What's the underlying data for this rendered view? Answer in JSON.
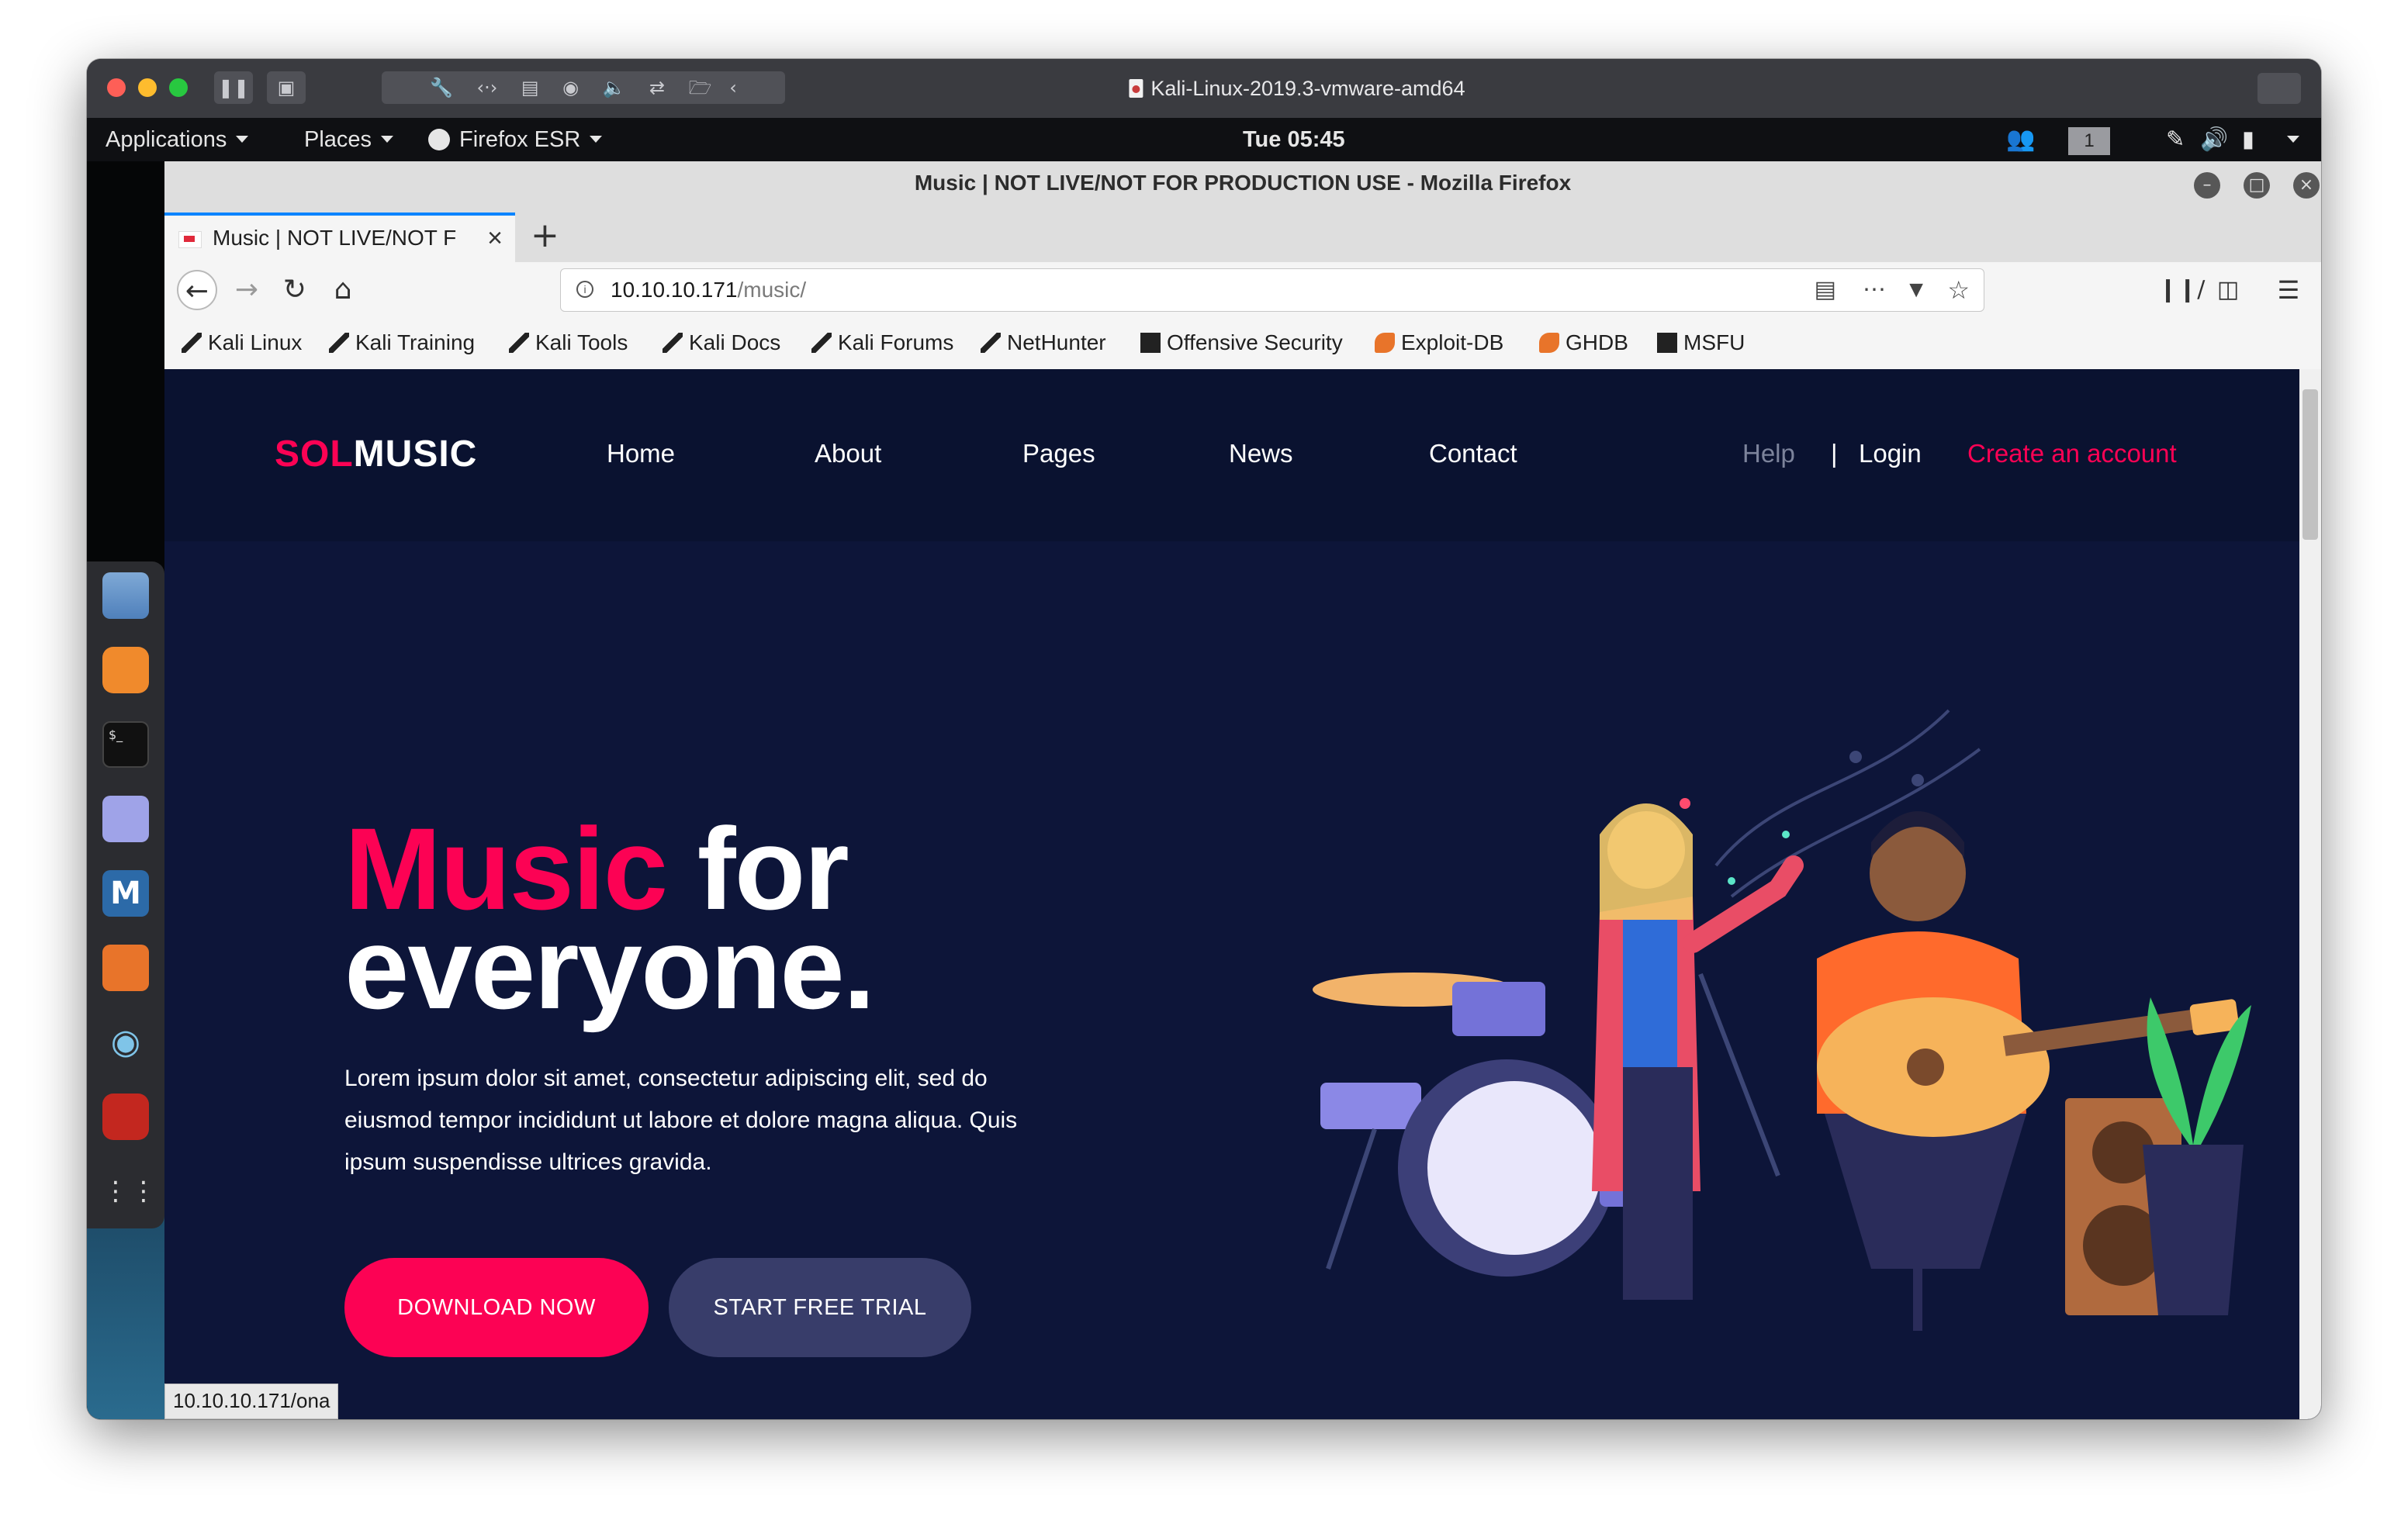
{
  "vm": {
    "title": "Kali-Linux-2019.3-vmware-amd64"
  },
  "panel": {
    "applications": "Applications",
    "places": "Places",
    "firefox_menu": "Firefox ESR",
    "clock": "Tue 05:45",
    "workspace": "1"
  },
  "dock": {
    "items": [
      "files-icon",
      "firefox-icon",
      "terminal-icon",
      "text-editor-icon",
      "metasploit-icon",
      "burpsuite-icon",
      "eye-icon",
      "cherrytree-icon",
      "show-apps-icon"
    ]
  },
  "browser": {
    "window_title": "Music | NOT LIVE/NOT FOR PRODUCTION USE - Mozilla Firefox",
    "tab_title": "Music | NOT LIVE/NOT F",
    "url_host": "10.10.10.171",
    "url_path": "/music/",
    "status_url": "10.10.10.171/ona",
    "bookmarks": [
      "Kali Linux",
      "Kali Training",
      "Kali Tools",
      "Kali Docs",
      "Kali Forums",
      "NetHunter",
      "Offensive Security",
      "Exploit-DB",
      "GHDB",
      "MSFU"
    ]
  },
  "site": {
    "logo_a": "SOL",
    "logo_b": "MUSIC",
    "nav": [
      "Home",
      "About",
      "Pages",
      "News",
      "Contact"
    ],
    "help": "Help",
    "separator": "|",
    "login": "Login",
    "create_account": "Create an account",
    "hero_pink": "Music",
    "hero_rest1": " for",
    "hero_rest2": "everyone.",
    "hero_text": "Lorem ipsum dolor sit amet, consectetur adipiscing elit, sed do eiusmod tempor incididunt ut labore et dolore magna aliqua. Quis ipsum suspendisse ultrices gravida.",
    "download_button": "DOWNLOAD NOW",
    "trial_button": "START FREE TRIAL"
  },
  "colors": {
    "accent": "#fc0254",
    "page_bg": "#0d1539",
    "header_bg": "#0a1230",
    "secondary_button": "#383d6a"
  }
}
